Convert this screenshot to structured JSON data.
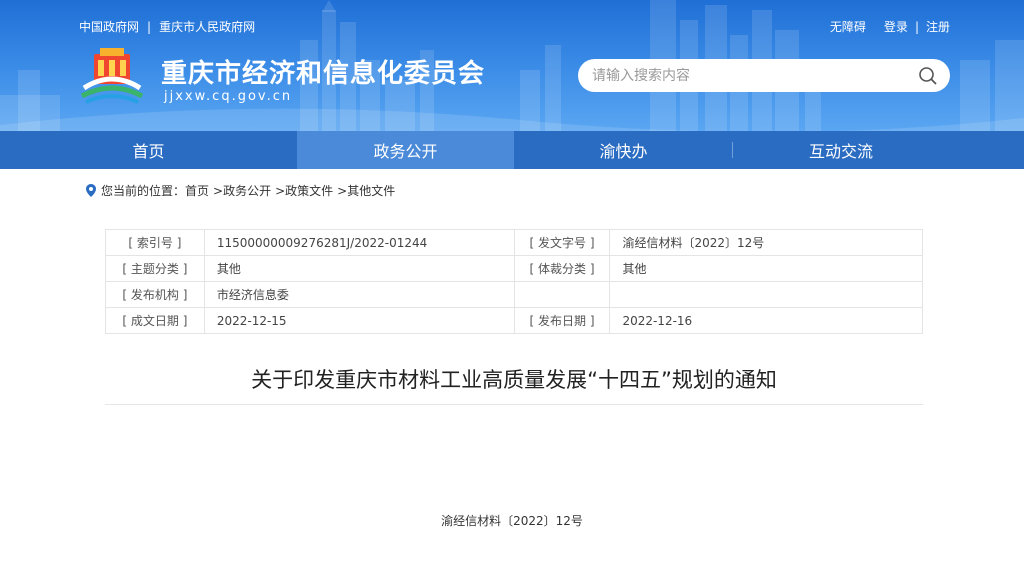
{
  "header": {
    "links": [
      "中国政府网",
      "重庆市人民政府网"
    ],
    "account": [
      "无障碍",
      "登录",
      "注册"
    ],
    "site_title": "重庆市经济和信息化委员会",
    "domain": "jjxxw.cq.gov.cn",
    "search_placeholder": "请输入搜索内容"
  },
  "nav": {
    "items": [
      "首页",
      "政务公开",
      "渝快办",
      "互动交流"
    ],
    "active": "政务公开"
  },
  "breadcrumb": {
    "prefix": "您当前的位置：",
    "items": [
      "首页",
      ">政务公开",
      ">政策文件",
      ">其他文件"
    ]
  },
  "info_table": [
    {
      "label1": "[ 索引号 ]",
      "value1": "11500000009276281J/2022-01244",
      "label2": "[ 发文字号 ]",
      "value2": "渝经信材料〔2022〕12号"
    },
    {
      "label1": "[ 主题分类 ]",
      "value1": "其他",
      "label2": "[ 体裁分类 ]",
      "value2": "其他"
    },
    {
      "label1": "[ 发布机构 ]",
      "value1": "市经济信息委",
      "label2": "",
      "value2": ""
    },
    {
      "label1": "[ 成文日期 ]",
      "value1": "2022-12-15",
      "label2": "[ 发布日期 ]",
      "value2": "2022-12-16"
    }
  ],
  "document": {
    "title": "关于印发重庆市材料工业高质量发展“十四五”规划的通知",
    "number": "渝经信材料〔2022〕12号"
  }
}
